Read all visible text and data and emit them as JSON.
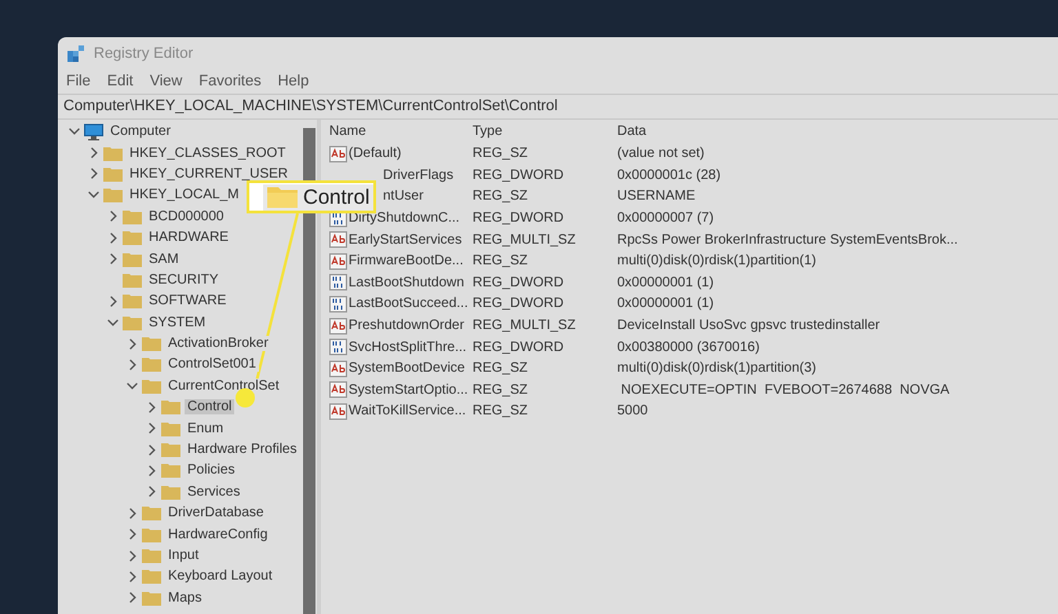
{
  "window": {
    "title": "Registry Editor"
  },
  "menu": [
    "File",
    "Edit",
    "View",
    "Favorites",
    "Help"
  ],
  "address": "Computer\\HKEY_LOCAL_MACHINE\\SYSTEM\\CurrentControlSet\\Control",
  "tree": [
    {
      "label": "Computer",
      "kind": "computer",
      "expanded": true,
      "selected": false,
      "children": [
        {
          "label": "HKEY_CLASSES_ROOT",
          "expanded": false,
          "selected": false
        },
        {
          "label": "HKEY_CURRENT_USER",
          "expanded": false,
          "selected": false
        },
        {
          "label": "HKEY_LOCAL_M",
          "expanded": true,
          "selected": false,
          "children": [
            {
              "label": "BCD000000",
              "expanded": false,
              "selected": false
            },
            {
              "label": "HARDWARE",
              "expanded": false,
              "selected": false
            },
            {
              "label": "SAM",
              "expanded": false,
              "selected": false
            },
            {
              "label": "SECURITY",
              "expandable": false,
              "selected": false
            },
            {
              "label": "SOFTWARE",
              "expanded": false,
              "selected": false
            },
            {
              "label": "SYSTEM",
              "expanded": true,
              "selected": false,
              "children": [
                {
                  "label": "ActivationBroker",
                  "expanded": false,
                  "selected": false
                },
                {
                  "label": "ControlSet001",
                  "expanded": false,
                  "selected": false
                },
                {
                  "label": "CurrentControlSet",
                  "expanded": true,
                  "selected": false,
                  "children": [
                    {
                      "label": "Control",
                      "expanded": false,
                      "selected": true
                    },
                    {
                      "label": "Enum",
                      "expanded": false,
                      "selected": false
                    },
                    {
                      "label": "Hardware Profiles",
                      "expanded": false,
                      "selected": false
                    },
                    {
                      "label": "Policies",
                      "expanded": false,
                      "selected": false
                    },
                    {
                      "label": "Services",
                      "expanded": false,
                      "selected": false
                    }
                  ]
                },
                {
                  "label": "DriverDatabase",
                  "expanded": false,
                  "selected": false
                },
                {
                  "label": "HardwareConfig",
                  "expanded": false,
                  "selected": false
                },
                {
                  "label": "Input",
                  "expanded": false,
                  "selected": false
                },
                {
                  "label": "Keyboard Layout",
                  "expanded": false,
                  "selected": false
                },
                {
                  "label": "Maps",
                  "expanded": false,
                  "selected": false
                }
              ]
            }
          ]
        }
      ]
    }
  ],
  "table": {
    "columns": [
      "Name",
      "Type",
      "Data"
    ],
    "rows": [
      {
        "name": "(Default)",
        "type": "REG_SZ",
        "data": "(value not set)",
        "kind": "string"
      },
      {
        "name": "DriverFlags",
        "type": "REG_DWORD",
        "data": "0x0000001c (28)",
        "kind": "covered"
      },
      {
        "name": "ntUser",
        "type": "REG_SZ",
        "data": "USERNAME",
        "kind": "covered"
      },
      {
        "name": "DirtyShutdownC...",
        "type": "REG_DWORD",
        "data": "0x00000007 (7)",
        "kind": "binary"
      },
      {
        "name": "EarlyStartServices",
        "type": "REG_MULTI_SZ",
        "data": "RpcSs Power BrokerInfrastructure SystemEventsBrok...",
        "kind": "string"
      },
      {
        "name": "FirmwareBootDe...",
        "type": "REG_SZ",
        "data": "multi(0)disk(0)rdisk(1)partition(1)",
        "kind": "string"
      },
      {
        "name": "LastBootShutdown",
        "type": "REG_DWORD",
        "data": "0x00000001 (1)",
        "kind": "binary"
      },
      {
        "name": "LastBootSucceed...",
        "type": "REG_DWORD",
        "data": "0x00000001 (1)",
        "kind": "binary"
      },
      {
        "name": "PreshutdownOrder",
        "type": "REG_MULTI_SZ",
        "data": "DeviceInstall UsoSvc gpsvc trustedinstaller",
        "kind": "string"
      },
      {
        "name": "SvcHostSplitThre...",
        "type": "REG_DWORD",
        "data": "0x00380000 (3670016)",
        "kind": "binary"
      },
      {
        "name": "SystemBootDevice",
        "type": "REG_SZ",
        "data": "multi(0)disk(0)rdisk(1)partition(3)",
        "kind": "string"
      },
      {
        "name": "SystemStartOptio...",
        "type": "REG_SZ",
        "data": " NOEXECUTE=OPTIN  FVEBOOT=2674688  NOVGA",
        "kind": "string"
      },
      {
        "name": "WaitToKillService...",
        "type": "REG_SZ",
        "data": "5000",
        "kind": "string"
      }
    ]
  },
  "callout": {
    "label": "Control"
  }
}
